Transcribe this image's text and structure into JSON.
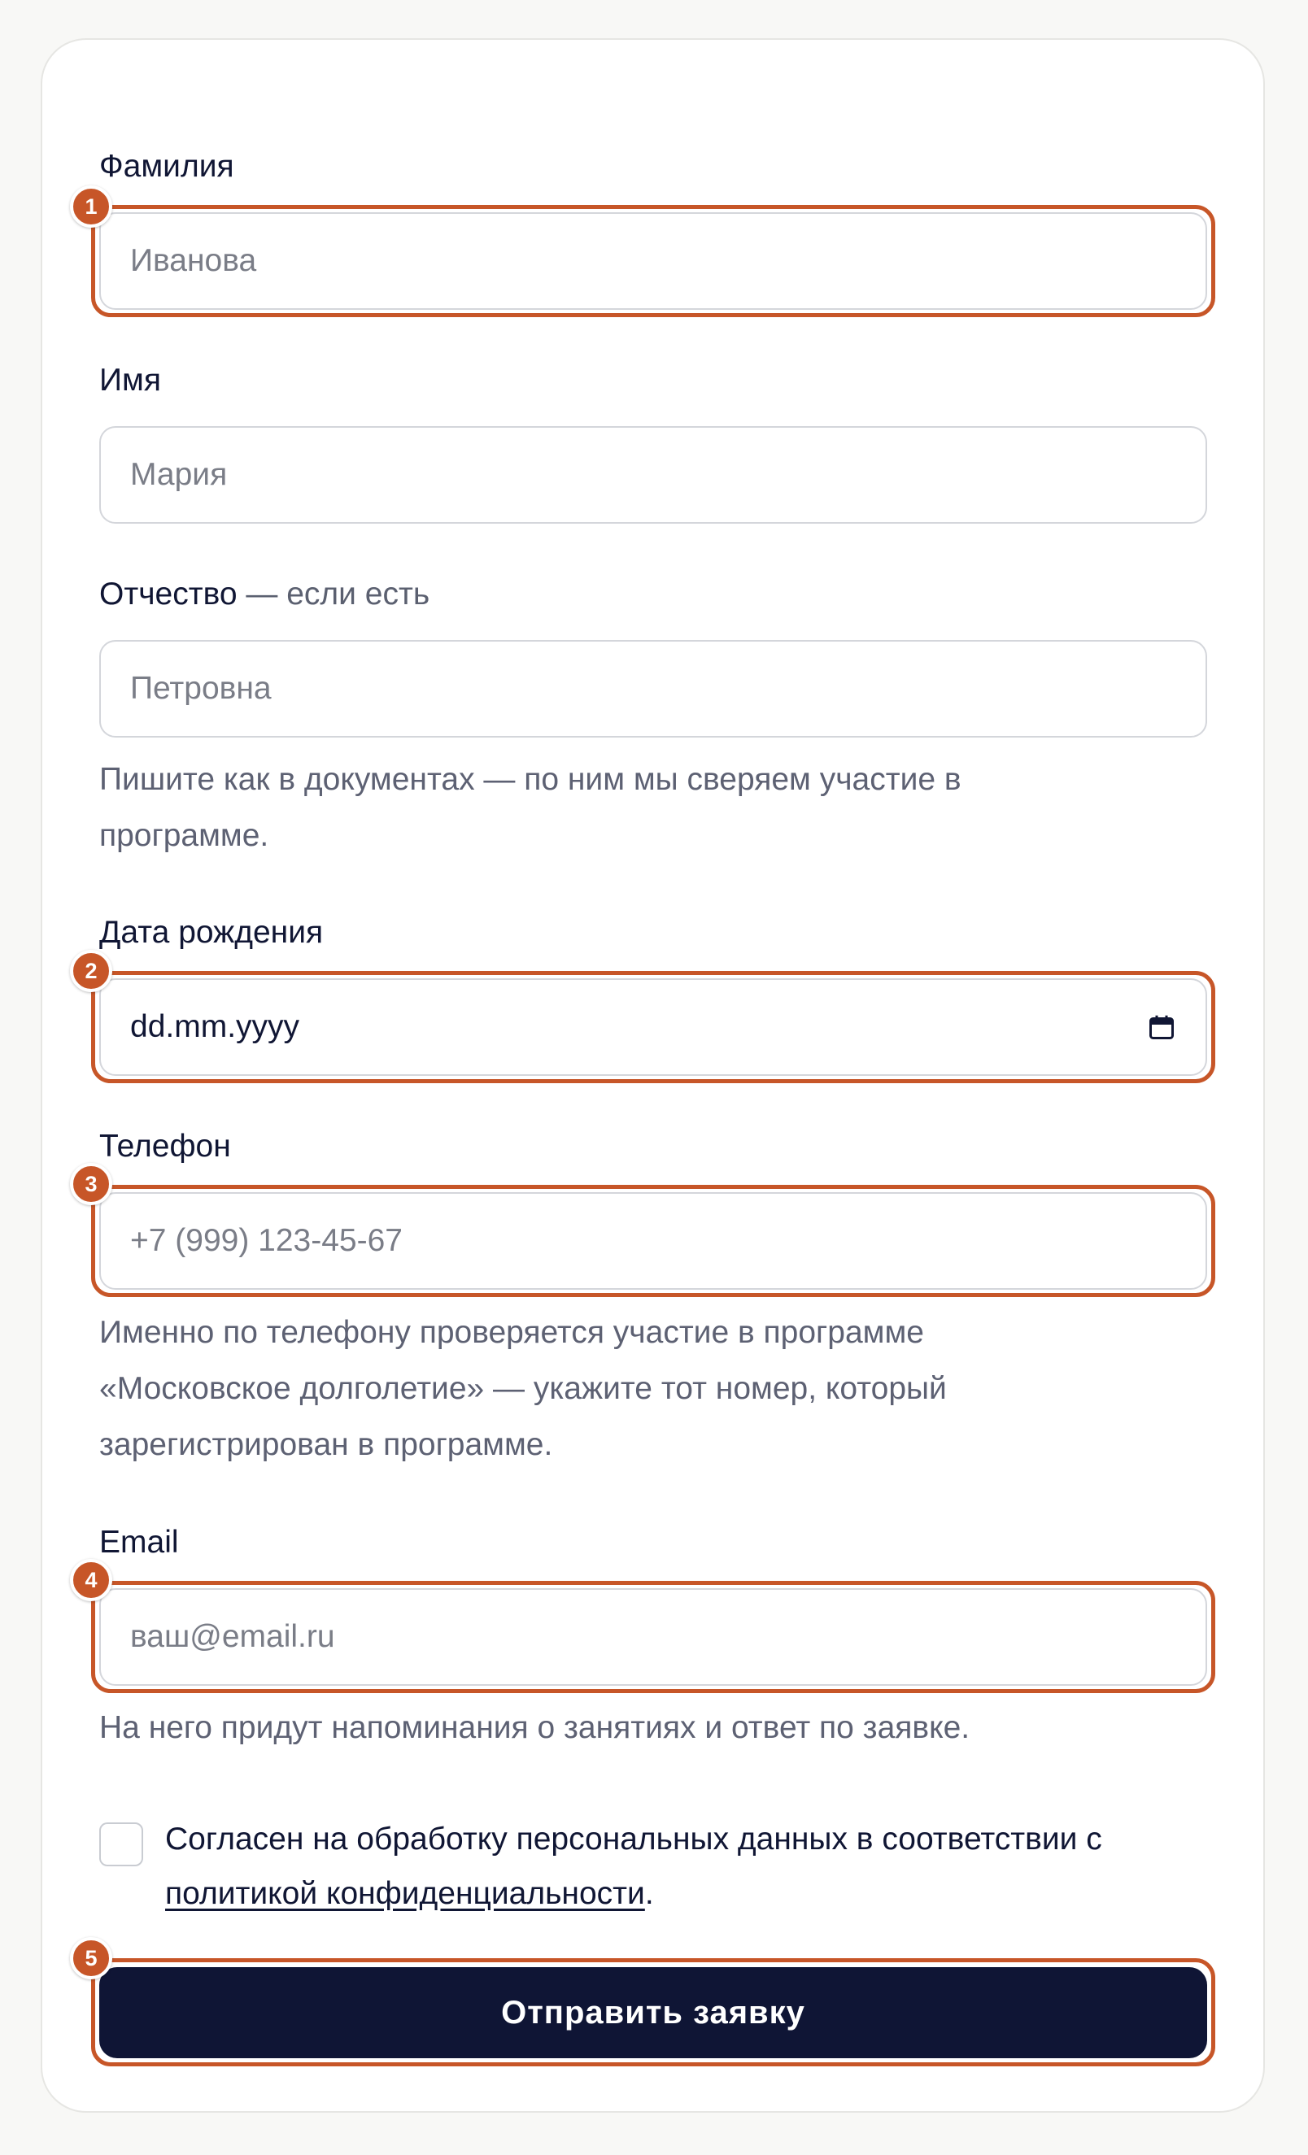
{
  "form": {
    "last_name": {
      "label": "Фамилия",
      "placeholder": "Иванова"
    },
    "first_name": {
      "label": "Имя",
      "placeholder": "Мария"
    },
    "middle_name": {
      "label": "Отчество",
      "note": " — если есть",
      "placeholder": "Петровна"
    },
    "name_hint": "Пишите как в документах — по ним мы сверяем участие в программе.",
    "birth_date": {
      "label": "Дата рождения",
      "value": "dd.mm.yyyy",
      "icon": "calendar-icon"
    },
    "phone": {
      "label": "Телефон",
      "placeholder": "+7 (999) 123-45-67",
      "hint": "Именно по телефону проверяется участие в программе «Московское долголетие» — укажите тот номер, который зарегистрирован в программе."
    },
    "email": {
      "label": "Email",
      "placeholder": "ваш@email.ru",
      "hint": "На него придут напоминания о занятиях и ответ по заявке."
    },
    "consent": {
      "text": "Согласен на обработку персональных данных в соответствии с ",
      "link": "политикой конфиденциальности",
      "suffix": "."
    },
    "submit_label": "Отправить заявку"
  },
  "annotations": [
    "1",
    "2",
    "3",
    "4",
    "5"
  ],
  "colors": {
    "accent": "#c75628",
    "button": "#0f1535",
    "text": "#101634",
    "muted": "#5d6173"
  }
}
